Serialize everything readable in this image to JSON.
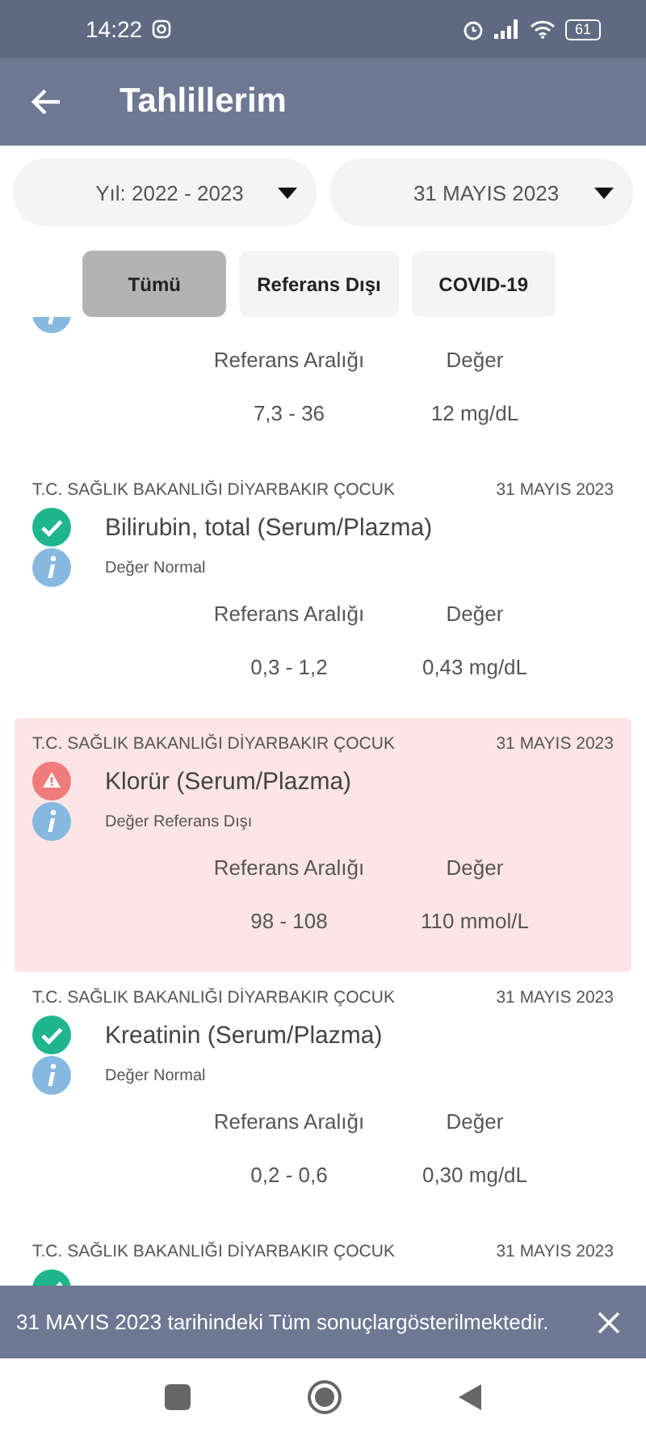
{
  "status_bar": {
    "time": "14:22",
    "battery": "61"
  },
  "app_bar": {
    "title": "Tahlillerim"
  },
  "filters": [
    {
      "value": "Yıl: 2022 - 2023"
    },
    {
      "value": "31 MAYIS 2023"
    }
  ],
  "chips": [
    {
      "label": "Tümü",
      "selected": true
    },
    {
      "label": "Referans Dışı",
      "selected": false
    },
    {
      "label": "COVID-19",
      "selected": false
    }
  ],
  "results": [
    {
      "reference_label": "Referans Aralığı",
      "value_label": "Değer",
      "reference": "7,3 - 36",
      "value": "12 mg/dL"
    },
    {
      "institution": "T.C. SAĞLIK BAKANLIĞI DİYARBAKIR ÇOCUK",
      "date": "31 MAYIS 2023",
      "title": "Bilirubin, total (Serum/Plazma)",
      "out_of_range": false,
      "note": "Değer Normal",
      "reference_label": "Referans Aralığı",
      "value_label": "Değer",
      "reference": "0,3 - 1,2",
      "value": "0,43 mg/dL"
    },
    {
      "institution": "T.C. SAĞLIK BAKANLIĞI DİYARBAKIR ÇOCUK",
      "date": "31 MAYIS 2023",
      "title": "Klorür (Serum/Plazma)",
      "out_of_range": true,
      "note": "Değer Referans Dışı",
      "reference_label": "Referans Aralığı",
      "value_label": "Değer",
      "reference": "98 - 108",
      "value": "110 mmol/L"
    },
    {
      "institution": "T.C. SAĞLIK BAKANLIĞI DİYARBAKIR ÇOCUK",
      "date": "31 MAYIS 2023",
      "title": "Kreatinin (Serum/Plazma)",
      "out_of_range": false,
      "note": "Değer Normal",
      "reference_label": "Referans Aralığı",
      "value_label": "Değer",
      "reference": "0,2 - 0,6",
      "value": "0,30 mg/dL"
    },
    {
      "institution": "T.C. SAĞLIK BAKANLIĞI DİYARBAKIR ÇOCUK",
      "date": "31 MAYIS 2023",
      "out_of_range": false
    }
  ],
  "snackbar": {
    "message": "31 MAYIS 2023 tarihindeki Tüm sonuçlargösterilmektedir."
  }
}
